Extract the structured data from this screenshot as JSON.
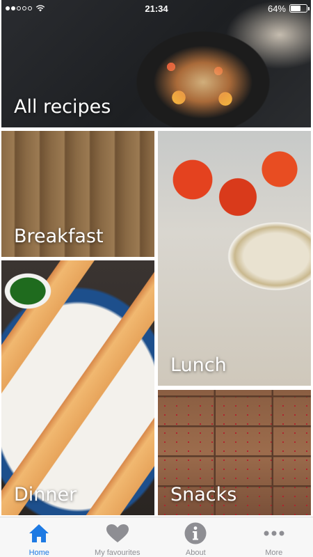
{
  "status_bar": {
    "time": "21:34",
    "battery": "64%",
    "battery_level": 0.64,
    "signal_filled": 2,
    "signal_total": 5
  },
  "tiles": {
    "all_recipes": "All recipes",
    "breakfast": "Breakfast",
    "lunch": "Lunch",
    "dinner": "Dinner",
    "snacks": "Snacks"
  },
  "tab_bar": {
    "tabs": [
      {
        "label": "Home",
        "icon": "home-icon",
        "active": true
      },
      {
        "label": "My favourites",
        "icon": "heart-icon",
        "active": false
      },
      {
        "label": "About",
        "icon": "info-icon",
        "active": false
      },
      {
        "label": "More",
        "icon": "more-icon",
        "active": false
      }
    ],
    "active_color": "#1e7ae3",
    "inactive_color": "#8e8e93"
  }
}
